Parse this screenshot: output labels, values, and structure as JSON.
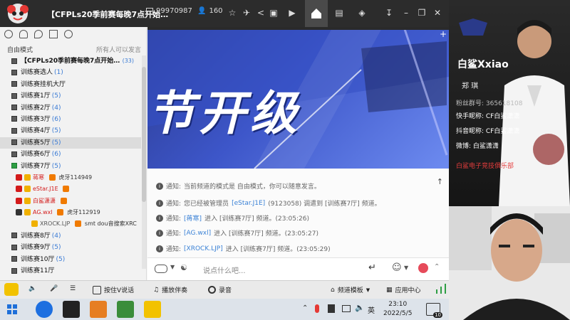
{
  "titlebar": {
    "title": "【CFPLs20季前赛每晚7点开始…",
    "id": "99970987",
    "count": "160"
  },
  "left_panel": {
    "mode": "自由模式",
    "permission": "所有人可以发言",
    "channels": [
      {
        "name": "【CFPLs20季前赛每晚7点开始…",
        "count": "(33)",
        "top": true
      },
      {
        "name": "训练赛选人",
        "count": "(1)"
      },
      {
        "name": "训练赛挂机大厅",
        "count": ""
      },
      {
        "name": "训练赛1厅",
        "count": "(5)"
      },
      {
        "name": "训练赛2厅",
        "count": "(4)"
      },
      {
        "name": "训练赛3厅",
        "count": "(6)"
      },
      {
        "name": "训练赛4厅",
        "count": "(5)"
      },
      {
        "name": "训练赛5厅",
        "count": "(5)",
        "selected": true
      },
      {
        "name": "训练赛6厅",
        "count": "(6)"
      },
      {
        "name": "训练赛7厅",
        "count": "(5)"
      }
    ],
    "users": [
      {
        "name": "蒋寒",
        "tag": "虎牙114949",
        "color": "red"
      },
      {
        "name": "eStar.J1E",
        "tag": "",
        "color": "red"
      },
      {
        "name": "白鲨潇潇",
        "tag": "",
        "color": "red"
      },
      {
        "name": "AG.wxl",
        "tag": "虎牙112919",
        "color": "red"
      },
      {
        "name": "XROCK.LJP",
        "tag": "smt dou音搜索XRC",
        "color": "gray"
      }
    ],
    "channels_after": [
      {
        "name": "训练赛8厅",
        "count": "(4)"
      },
      {
        "name": "训练赛9厅",
        "count": "(5)"
      },
      {
        "name": "训练赛10厅",
        "count": "(5)"
      },
      {
        "name": "训练赛11厅",
        "count": ""
      }
    ]
  },
  "banner": {
    "headline": "节开级"
  },
  "chat": {
    "messages": [
      {
        "prefix": "通知:",
        "text": "当前频道的模式是 自由模式，你可以随意发言。",
        "blue": ""
      },
      {
        "prefix": "通知:",
        "text": "您已经被管理员 ",
        "blue": "[eStar.J1E]",
        "rest": "(9123058) 调遣到 [训练赛7厅] 频道。"
      },
      {
        "prefix": "通知:",
        "blue": "[蒋寒]",
        "text": " 进入 [训练赛7厅] 频道。(23:05:26)"
      },
      {
        "prefix": "通知:",
        "blue": "[AG.wxl]",
        "text": " 进入 [训练赛7厅] 频道。(23:05:27)"
      },
      {
        "prefix": "通知:",
        "blue": "[XROCK.LJP]",
        "text": " 进入 [训练赛7厅] 频道。(23:05:29)"
      }
    ],
    "input_placeholder": "说点什么吧..."
  },
  "toolbar": {
    "push_to_talk": "按住V说话",
    "accompany": "播放伴奏",
    "record": "录音",
    "channel_template": "频道模板",
    "app_center": "应用中心"
  },
  "taskbar": {
    "time": "23:10",
    "date": "2022/5/5",
    "lang": "英",
    "notif": "10"
  },
  "streamer": {
    "name": "白鲨Xxiao",
    "sub": "郑 琪",
    "fans": "粉丝群号: 365618108",
    "kuaishou": "快手昵称: CF白鲨潇潇",
    "douyin": "抖音昵称: CF白鲨潇潇",
    "weibo": "微博: 白鲨潇潇",
    "club": "白鲨电子竞技俱乐部"
  },
  "colors": {
    "accent_blue": "#3b82d6",
    "user_red": "#d31b1b",
    "titlebar": "#2c2c2c"
  }
}
